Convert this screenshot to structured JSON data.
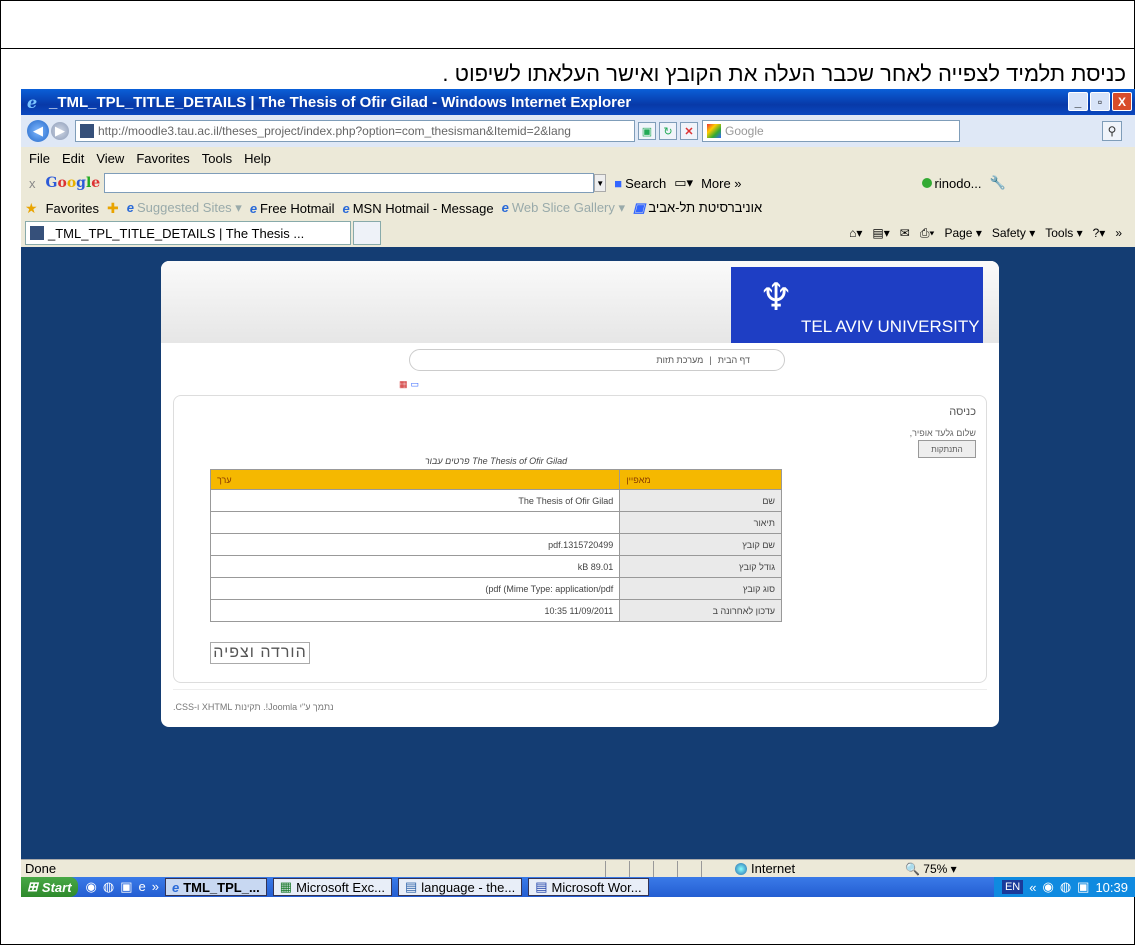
{
  "caption": "כניסת תלמיד לצפייה לאחר שכבר  העלה את הקובץ ואישר העלאתו לשיפוט .",
  "window": {
    "title": "_TML_TPL_TITLE_DETAILS | The Thesis of Ofir Gilad - Windows Internet Explorer",
    "minimize": "_",
    "maximize": "▫",
    "close": "X"
  },
  "address": {
    "url": "http://moodle3.tau.ac.il/theses_project/index.php?option=com_thesisman&Itemid=2&lang",
    "search_placeholder": "Google"
  },
  "menu": [
    "File",
    "Edit",
    "View",
    "Favorites",
    "Tools",
    "Help"
  ],
  "google_toolbar": {
    "close": "x",
    "logo": "Google",
    "search": "Search",
    "more": "More »",
    "user": "rinodo..."
  },
  "favorites": {
    "label": "Favorites",
    "items": [
      "Suggested Sites ▾",
      "Free Hotmail",
      "MSN Hotmail - Message",
      "Web Slice Gallery ▾",
      "אוניברסיטת תל-אביב"
    ]
  },
  "tab": {
    "title": "_TML_TPL_TITLE_DETAILS | The Thesis ...",
    "commands": [
      "Page ▾",
      "Safety ▾",
      "Tools ▾"
    ]
  },
  "site": {
    "logo_text": "TEL AVIV UNIVERSITY",
    "nav": [
      "דף הבית",
      "מערכת תזות"
    ],
    "login": {
      "heading": "כניסה",
      "greeting": "שלום גלעד אופיר,",
      "logout": "התנתקות"
    },
    "details_title": "פרטים עבור The Thesis of Ofir Gilad",
    "table": {
      "header_value": "ערך",
      "header_attr": "מאפיין",
      "rows": [
        {
          "label": "שם",
          "value": "The Thesis of Ofir Gilad"
        },
        {
          "label": "תיאור",
          "value": ""
        },
        {
          "label": "שם קובץ",
          "value": "pdf.1315720499"
        },
        {
          "label": "גודל קובץ",
          "value": "kB 89.01"
        },
        {
          "label": "סוג קובץ",
          "value": "(pdf (Mime Type: application/pdf"
        },
        {
          "label": "עדכון לאחרונה ב",
          "value": "10:35 11/09/2011"
        }
      ]
    },
    "download_button": "הורדה וצפיה",
    "footer": "נתמך ע\"י Joomla!. תקינות XHTML ו-CSS."
  },
  "status": {
    "done": "Done",
    "zone": "Internet",
    "zoom": "75%"
  },
  "taskbar": {
    "start": "Start",
    "tasks": [
      "TML_TPL_...",
      "Microsoft Exc...",
      "language - the...",
      "Microsoft Wor..."
    ],
    "lang": "EN",
    "clock": "10:39"
  }
}
